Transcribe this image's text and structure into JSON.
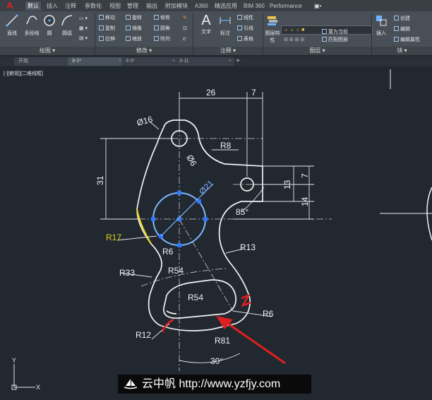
{
  "app_menu": {
    "label": "A"
  },
  "ribbon_tabs": [
    "默认",
    "插入",
    "注释",
    "参数化",
    "视图",
    "管理",
    "输出",
    "附加模块",
    "A360",
    "精选应用",
    "BIM 360",
    "Performance"
  ],
  "ribbon_groups": {
    "draw": {
      "label": "绘图 ▾",
      "tools": [
        "直线",
        "多段线",
        "圆",
        "圆弧"
      ]
    },
    "modify": {
      "label": "修改 ▾",
      "tools": [
        "移动",
        "旋转",
        "修剪",
        "复制",
        "镜像",
        "圆角",
        "拉伸",
        "缩放",
        "阵列"
      ]
    },
    "annotation": {
      "label": "注释 ▾",
      "tools": [
        "文字",
        "标注",
        "线性",
        "引线",
        "表格"
      ]
    },
    "layers": {
      "label": "图层 ▾",
      "tools": [
        "图层特性",
        "置为当前",
        "匹配图层"
      ]
    },
    "block": {
      "label": "块 ▾",
      "tools": [
        "插入",
        "创建",
        "编辑",
        "编辑属性"
      ]
    }
  },
  "doc_tabs": [
    "开始",
    "3-1*",
    "3-3*",
    "3-11"
  ],
  "viewport_label": "[-][俯视][二维线框]",
  "dimensions": {
    "top_width": "26",
    "top_right": "7",
    "hole_dia": "Ø16",
    "small_dia": "Ø6",
    "r8": "R8",
    "height_31": "31",
    "v13": "13",
    "v7": "7",
    "v14": "14",
    "circle_dia": "Ø21",
    "angle_85": "85°",
    "r17": "R17",
    "r6_left": "R6",
    "r13": "R13",
    "r33": "R33",
    "r54_outer": "R54",
    "r54_inner": "R54",
    "r6_right": "R6",
    "r12": "R12",
    "r81": "R81",
    "angle_30": "30°"
  },
  "ucs": {
    "x": "X",
    "y": "Y"
  },
  "watermark": {
    "text": "云中帆 http://www.yzfjy.com"
  }
}
